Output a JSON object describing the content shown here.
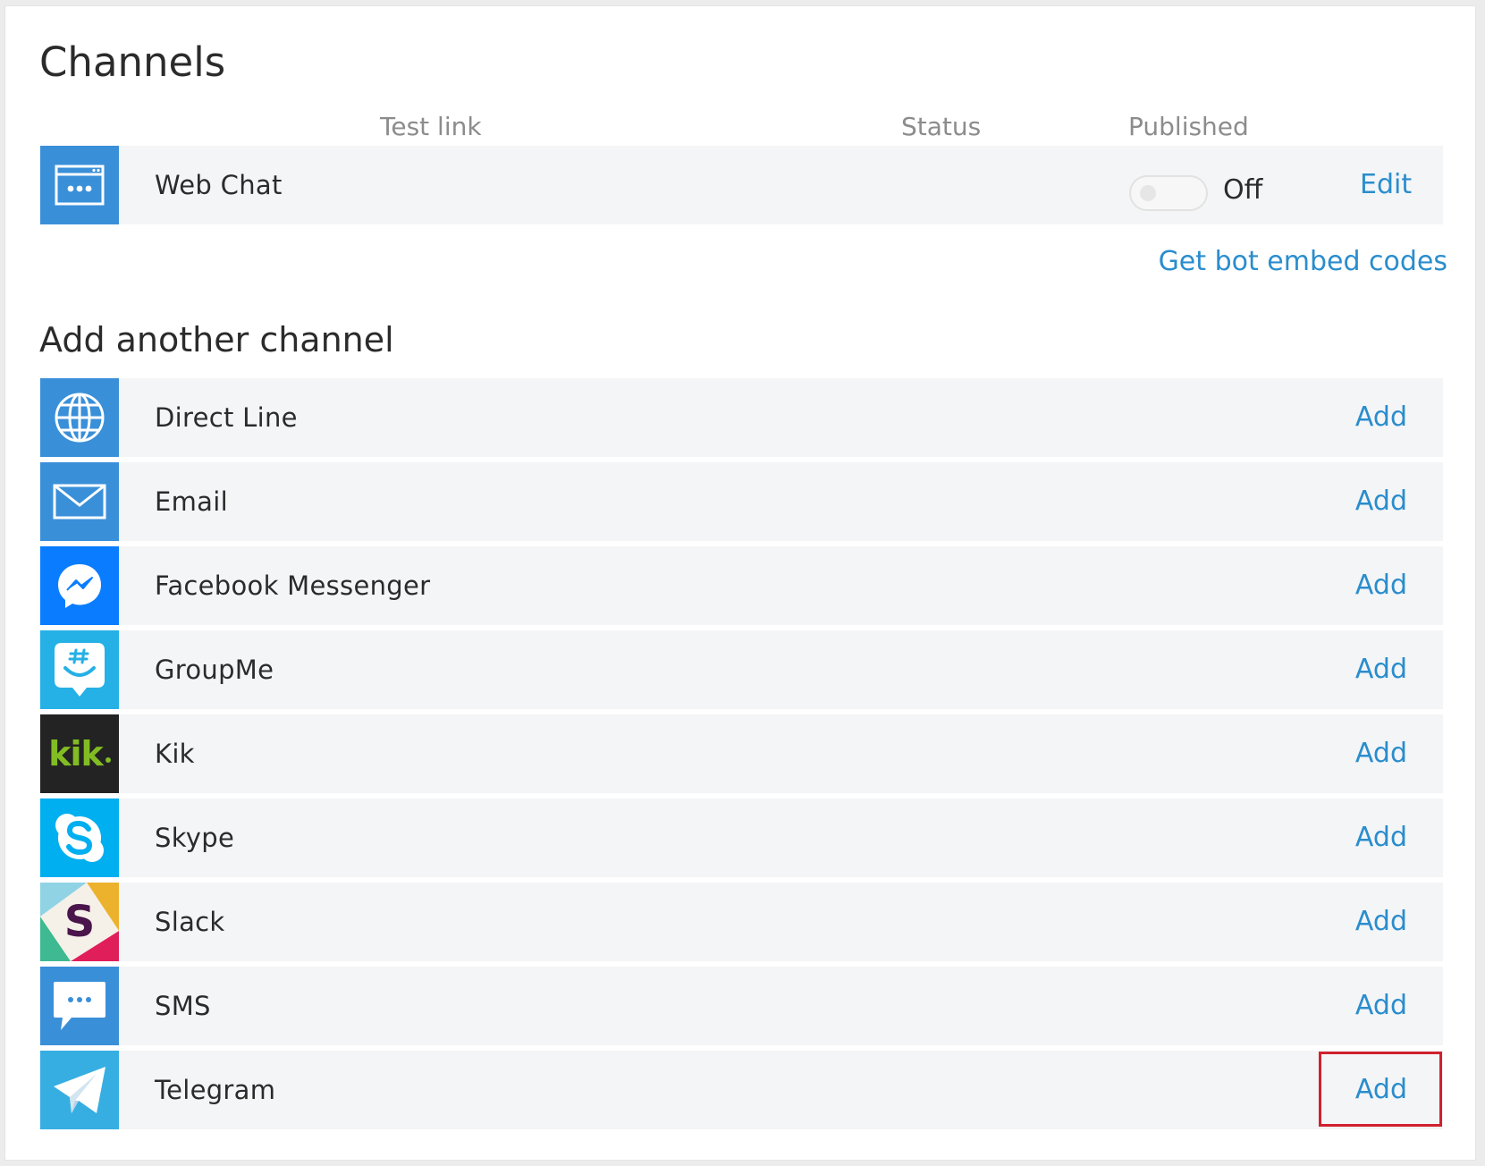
{
  "page": {
    "title": "Channels",
    "subtitle": "Add another channel",
    "embed_link": "Get bot embed codes"
  },
  "columns": {
    "test_link": "Test link",
    "status": "Status",
    "published": "Published"
  },
  "active_channel": {
    "name": "Web Chat",
    "icon": "web-chat-icon",
    "published": false,
    "toggle_text": "Off",
    "edit_label": "Edit"
  },
  "channels": [
    {
      "name": "Direct Line",
      "icon": "globe-icon",
      "add_label": "Add"
    },
    {
      "name": "Email",
      "icon": "envelope-icon",
      "add_label": "Add"
    },
    {
      "name": "Facebook Messenger",
      "icon": "messenger-icon",
      "add_label": "Add"
    },
    {
      "name": "GroupMe",
      "icon": "groupme-icon",
      "add_label": "Add"
    },
    {
      "name": "Kik",
      "icon": "kik-logo",
      "add_label": "Add",
      "logo_text": "kik"
    },
    {
      "name": "Skype",
      "icon": "skype-icon",
      "add_label": "Add"
    },
    {
      "name": "Slack",
      "icon": "slack-icon",
      "add_label": "Add"
    },
    {
      "name": "SMS",
      "icon": "sms-icon",
      "add_label": "Add"
    },
    {
      "name": "Telegram",
      "icon": "telegram-icon",
      "add_label": "Add"
    }
  ],
  "colors": {
    "link": "#2a8dcd",
    "row_bg": "#f4f5f7",
    "icon_blue": "#3a8fd9",
    "messenger_blue": "#0a7cff",
    "groupme_blue": "#25b0e6",
    "kik_bg": "#232323",
    "kik_green": "#82bc23",
    "skype_blue": "#00aff0",
    "telegram_blue": "#37aee2",
    "highlight": "#d0212e"
  }
}
